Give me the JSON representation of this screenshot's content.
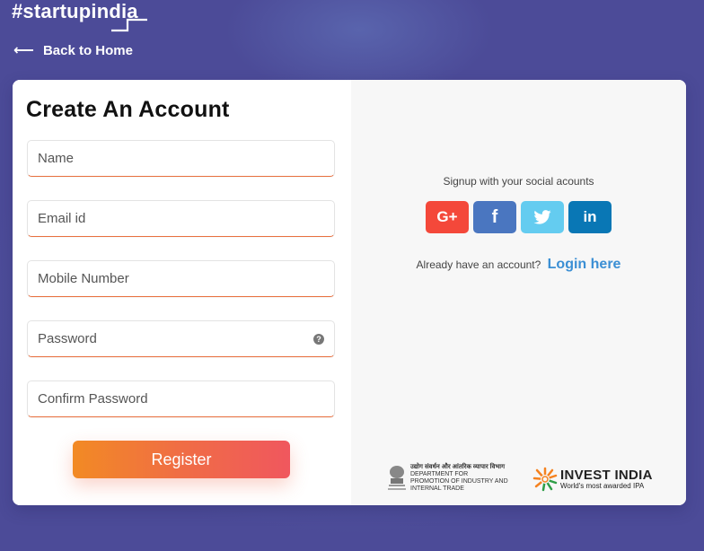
{
  "brand": {
    "logo_text": "#startupindia"
  },
  "nav": {
    "back_label": "Back to Home",
    "back_icon": "arrow-left-icon"
  },
  "form": {
    "title": "Create An Account",
    "fields": [
      {
        "name": "name",
        "placeholder": "Name",
        "value": ""
      },
      {
        "name": "email",
        "placeholder": "Email id",
        "value": ""
      },
      {
        "name": "mobile",
        "placeholder": "Mobile Number",
        "value": ""
      },
      {
        "name": "password",
        "placeholder": "Password",
        "value": "",
        "help_icon": "question-circle-icon"
      },
      {
        "name": "confirm_password",
        "placeholder": "Confirm Password",
        "value": ""
      }
    ],
    "register_label": "Register"
  },
  "social": {
    "title": "Signup with your social acounts",
    "buttons": [
      {
        "name": "google-plus",
        "glyph": "G+",
        "color": "#f4483a"
      },
      {
        "name": "facebook",
        "glyph": "f",
        "color": "#4a76c0"
      },
      {
        "name": "twitter",
        "glyph": "🐦",
        "color": "#64ccf0"
      },
      {
        "name": "linkedin",
        "glyph": "in",
        "color": "#0977b5"
      }
    ],
    "login_prompt": "Already have an account?",
    "login_link": "Login here"
  },
  "footer_logos": {
    "dipp": {
      "hindi": "उद्योग संवर्धन और आंतरिक व्यापार विभाग",
      "line1": "DEPARTMENT FOR",
      "line2": "PROMOTION OF INDUSTRY AND",
      "line3": "INTERNAL TRADE"
    },
    "invest_india": {
      "title": "INVEST INDIA",
      "tagline": "World's most awarded IPA"
    }
  },
  "colors": {
    "accent_orange": "#e8703f",
    "link_blue": "#3b8fd4",
    "background_purple": "#4f519c"
  }
}
